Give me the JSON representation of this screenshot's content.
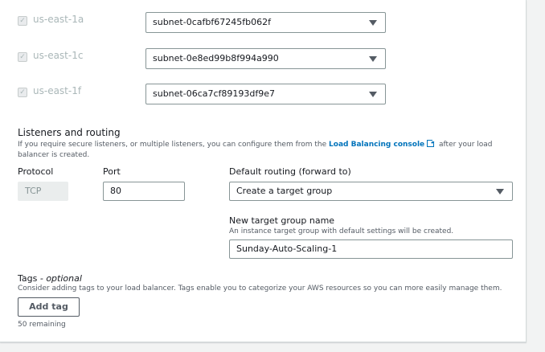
{
  "availability_zones": [
    {
      "zone": "us-east-1a",
      "checked": true,
      "subnet": "subnet-0cafbf67245fb062f"
    },
    {
      "zone": "us-east-1c",
      "checked": true,
      "subnet": "subnet-0e8ed99b8f994a990"
    },
    {
      "zone": "us-east-1f",
      "checked": true,
      "subnet": "subnet-06ca7cf89193df9e7"
    }
  ],
  "listeners": {
    "title": "Listeners and routing",
    "desc_before": "If you require secure listeners, or multiple listeners, you can configure them from the ",
    "link": "Load Balancing console",
    "desc_after": " after your load balancer is created.",
    "protocol_label": "Protocol",
    "protocol_value": "TCP",
    "port_label": "Port",
    "port_value": "80",
    "routing_label": "Default routing (forward to)",
    "routing_value": "Create a target group",
    "tg_name_label": "New target group name",
    "tg_name_desc": "An instance target group with default settings will be created.",
    "tg_name_value": "Sunday-Auto-Scaling-1"
  },
  "tags": {
    "title": "Tags",
    "title_suffix": " - optional",
    "desc": "Consider adding tags to your load balancer. Tags enable you to categorize your AWS resources so you can more easily manage them.",
    "add_button": "Add tag",
    "remaining": "50 remaining"
  }
}
